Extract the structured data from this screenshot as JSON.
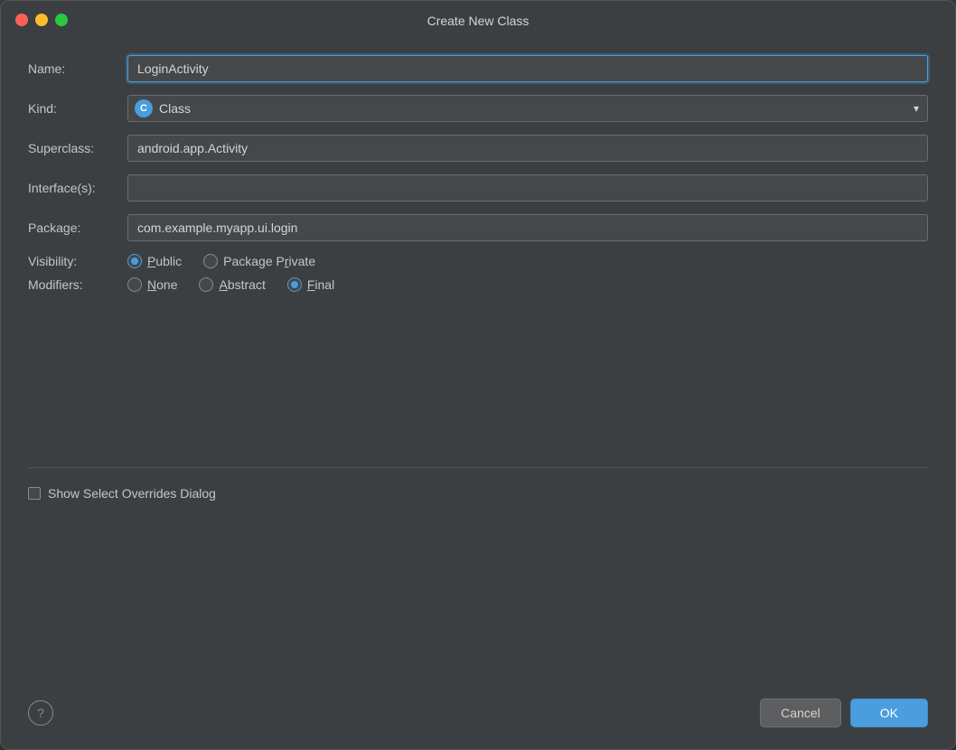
{
  "window": {
    "title": "Create New Class"
  },
  "form": {
    "name_label": "Name:",
    "name_value": "LoginActivity",
    "kind_label": "Kind:",
    "kind_value": "Class",
    "kind_icon": "C",
    "superclass_label": "Superclass:",
    "superclass_value": "android.app.Activity",
    "interfaces_label": "Interface(s):",
    "interfaces_value": "",
    "package_label": "Package:",
    "package_value": "com.example.myapp.ui.login",
    "visibility_label": "Visibility:",
    "modifiers_label": "Modifiers:",
    "visibility_options": [
      {
        "value": "public",
        "label": "Public",
        "checked": true
      },
      {
        "value": "package_private",
        "label": "Package Private",
        "checked": false
      }
    ],
    "modifier_options": [
      {
        "value": "none",
        "label": "None",
        "checked": false
      },
      {
        "value": "abstract",
        "label": "Abstract",
        "checked": false
      },
      {
        "value": "final",
        "label": "Final",
        "checked": true
      }
    ],
    "checkbox_label": "Show Select Overrides Dialog",
    "checkbox_checked": false
  },
  "buttons": {
    "cancel": "Cancel",
    "ok": "OK",
    "help": "?"
  }
}
